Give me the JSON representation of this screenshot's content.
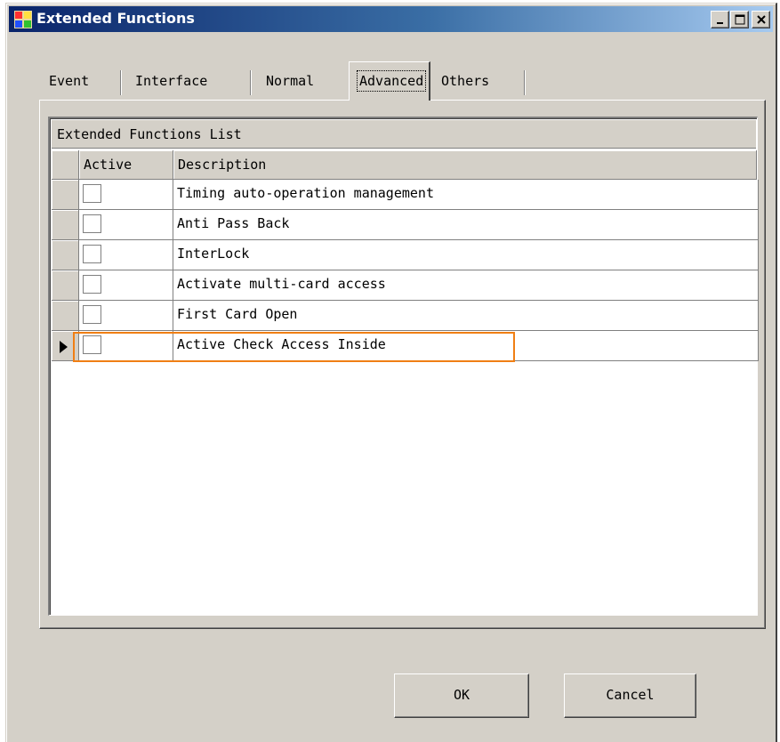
{
  "window": {
    "title": "Extended Functions"
  },
  "tabs": [
    {
      "label": "Event"
    },
    {
      "label": "Interface"
    },
    {
      "label": "Normal"
    },
    {
      "label": "Advanced",
      "selected": true
    },
    {
      "label": "Others"
    }
  ],
  "grid": {
    "caption": "Extended Functions List",
    "columns": {
      "active": "Active",
      "description": "Description"
    },
    "rows": [
      {
        "active": false,
        "description": "Timing auto-operation management"
      },
      {
        "active": false,
        "description": "Anti Pass Back"
      },
      {
        "active": false,
        "description": "InterLock"
      },
      {
        "active": false,
        "description": "Activate multi-card access"
      },
      {
        "active": false,
        "description": "First Card Open"
      },
      {
        "active": false,
        "description": "Active Check Access Inside",
        "current": true
      }
    ]
  },
  "buttons": {
    "ok": "OK",
    "cancel": "Cancel"
  },
  "colors": {
    "title_bar_start": "#0a246a",
    "title_bar_end": "#a6caf0",
    "window_face": "#d4d0c8",
    "highlight_outline": "#f07f14"
  },
  "icons": {
    "app": "app-window-icon",
    "minimize": "minimize-icon",
    "maximize": "maximize-icon",
    "close": "close-icon",
    "row_pointer": "current-row-pointer-icon"
  }
}
